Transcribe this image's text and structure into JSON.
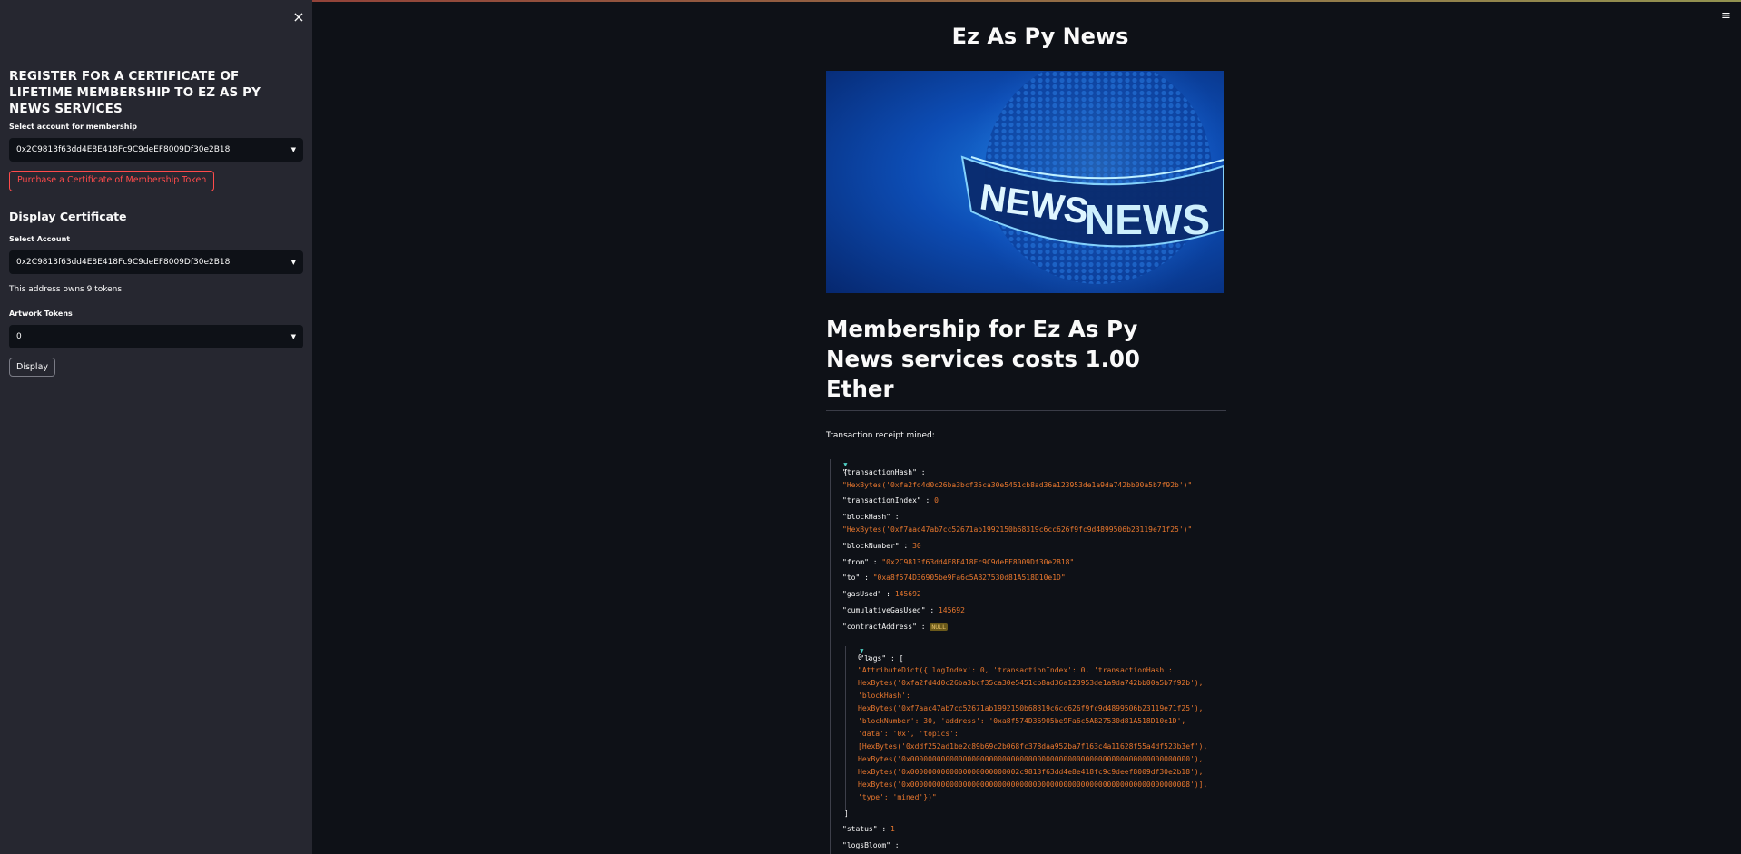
{
  "sidebar": {
    "close_icon": "×",
    "title": "REGISTER FOR A CERTIFICATE OF LIFETIME MEMBERSHIP TO EZ AS PY NEWS SERVICES",
    "select_account_label": "Select account for membership",
    "select_account_value": "0x2C9813f63dd4E8E418Fc9C9deEF8009Df30e2B18",
    "purchase_button": "Purchase a Certificate of Membership Token",
    "display_heading": "Display Certificate",
    "select_account2_label": "Select Account",
    "select_account2_value": "0x2C9813f63dd4E8E418Fc9C9deEF8009Df30e2B18",
    "owns_text": "This address owns 9 tokens",
    "artwork_label": "Artwork Tokens",
    "artwork_value": "0",
    "display_button": "Display"
  },
  "main": {
    "menu_icon": "≡",
    "title": "Ez As Py News",
    "hero_words": [
      "NEWS",
      "NEWS"
    ],
    "headline": "Membership for Ez As Py News services costs 1.00 Ether",
    "receipt_label": "Transaction receipt mined:"
  },
  "receipt": {
    "open_brace": "{",
    "transactionHash_key": "\"transactionHash\" :",
    "transactionHash_val": "\"HexBytes('0xfa2fd4d0c26ba3bcf35ca30e5451cb8ad36a123953de1a9da742bb00a5b7f92b')\"",
    "transactionIndex_key": "\"transactionIndex\" :",
    "transactionIndex_val": "0",
    "blockHash_key": "\"blockHash\" :",
    "blockHash_val": "\"HexBytes('0xf7aac47ab7cc52671ab1992150b68319c6cc626f9fc9d4899506b23119e71f25')\"",
    "blockNumber_key": "\"blockNumber\" :",
    "blockNumber_val": "30",
    "from_key": "\"from\" :",
    "from_val": "\"0x2C9813f63dd4E8E418Fc9C9deEF8009Df30e2B18\"",
    "to_key": "\"to\" :",
    "to_val": "\"0xa8f574D36905be9Fa6c5AB27530d81A518D10e1D\"",
    "gasUsed_key": "\"gasUsed\" :",
    "gasUsed_val": "145692",
    "cumulative_key": "\"cumulativeGasUsed\" :",
    "cumulative_val": "145692",
    "contract_key": "\"contractAddress\" :",
    "contract_val": "NULL",
    "logs_key": "\"logs\" : [",
    "logs_index": "0 :",
    "logs_lines": [
      "\"AttributeDict({'logIndex': 0, 'transactionIndex': 0, 'transactionHash':",
      "HexBytes('0xfa2fd4d0c26ba3bcf35ca30e5451cb8ad36a123953de1a9da742bb00a5b7f92b'),",
      "'blockHash':",
      "HexBytes('0xf7aac47ab7cc52671ab1992150b68319c6cc626f9fc9d4899506b23119e71f25'),",
      "'blockNumber': 30, 'address': '0xa8f574D36905be9Fa6c5AB27530d81A518D10e1D',",
      "'data': '0x', 'topics':",
      "[HexBytes('0xddf252ad1be2c89b69c2b068fc378daa952ba7f163c4a11628f55a4df523b3ef'),",
      "HexBytes('0x0000000000000000000000000000000000000000000000000000000000000000'),",
      "HexBytes('0x0000000000000000000000002c9813f63dd4e8e418fc9c9deef8009df30e2b18'),",
      "HexBytes('0x0000000000000000000000000000000000000000000000000000000000000008')],",
      "'type': 'mined'})\""
    ],
    "logs_close": "]",
    "status_key": "\"status\" :",
    "status_val": "1",
    "logsBloom_key": "\"logsBloom\" :"
  }
}
